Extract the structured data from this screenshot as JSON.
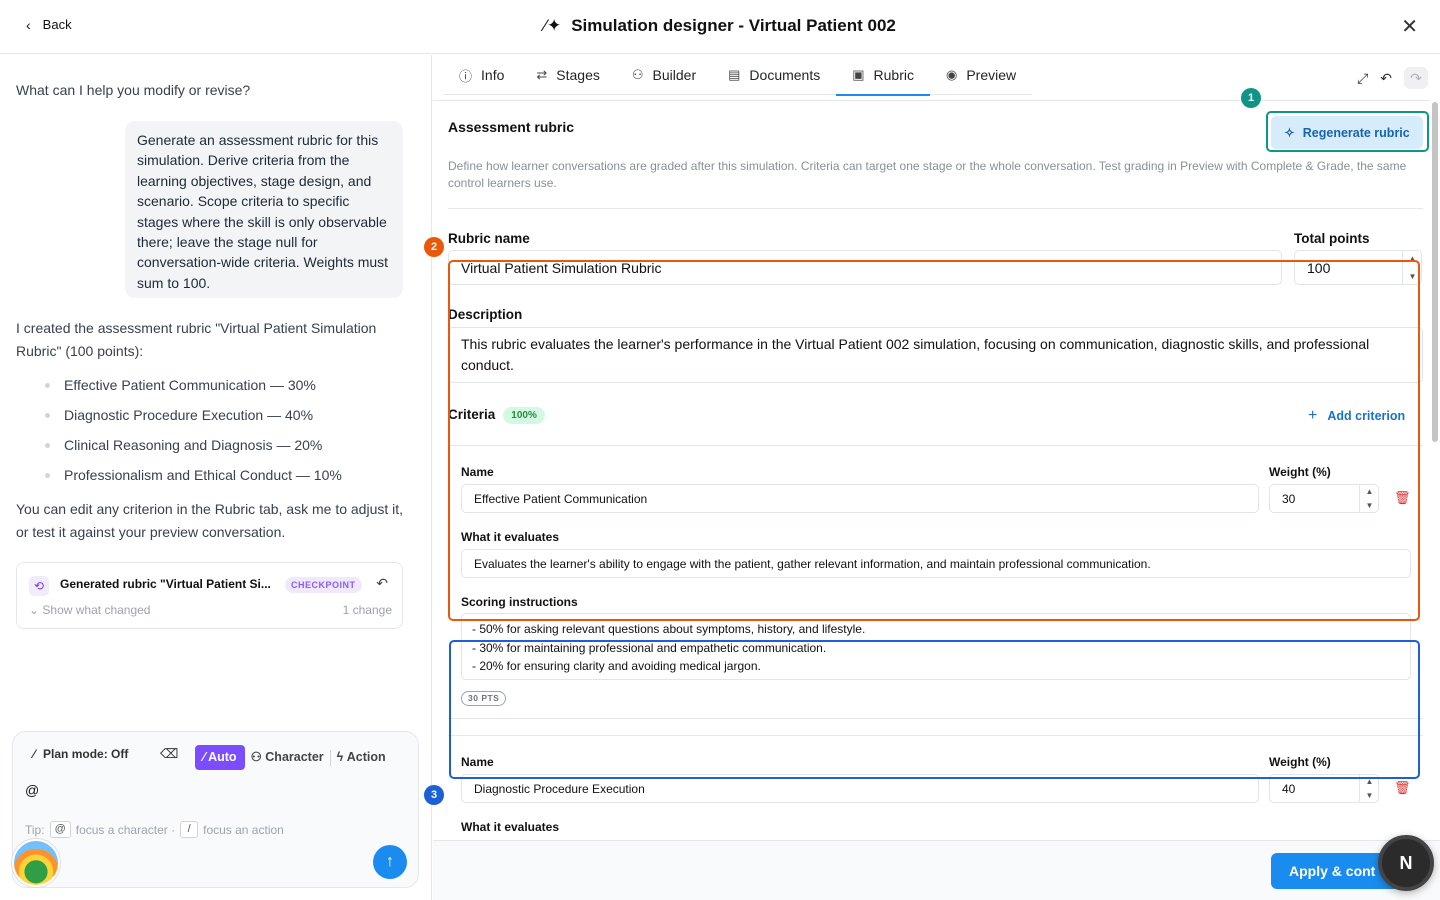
{
  "header": {
    "back_label": "Back",
    "title": "Simulation designer - Virtual Patient 002"
  },
  "chat": {
    "prompt": "What can I help you modify or revise?",
    "user_message": "Generate an assessment rubric for this simulation. Derive criteria from the learning objectives, stage design, and scenario. Scope criteria to specific stages where the skill is only observable there; leave the stage null for conversation-wide criteria. Weights must sum to 100.",
    "assistant_intro": "I created the assessment rubric \"Virtual Patient Simulation Rubric\" (100 points):",
    "bullets": [
      "Effective Patient Communication — 30%",
      "Diagnostic Procedure Execution — 40%",
      "Clinical Reasoning and Diagnosis — 20%",
      "Professionalism and Ethical Conduct — 10%"
    ],
    "assistant_outro": "You can edit any criterion in the Rubric tab, ask me to adjust it, or test it against your preview conversation.",
    "checkpoint": {
      "title": "Generated rubric \"Virtual Patient Si...",
      "badge": "CHECKPOINT",
      "show_changes": "Show what changed",
      "change_count": "1 change"
    }
  },
  "composer": {
    "plan_mode": "Plan mode: Off",
    "modes": {
      "auto": "Auto",
      "character": "Character",
      "action": "Action"
    },
    "input_value": "@",
    "tip_prefix": "Tip:",
    "tip_key1": "@",
    "tip_text1": "focus a character ·",
    "tip_key2": "/",
    "tip_text2": "focus an action"
  },
  "tabs": [
    {
      "label": "Info",
      "icon": "info-icon"
    },
    {
      "label": "Stages",
      "icon": "stages-icon"
    },
    {
      "label": "Builder",
      "icon": "users-icon"
    },
    {
      "label": "Documents",
      "icon": "document-icon"
    },
    {
      "label": "Rubric",
      "icon": "clipboard-icon",
      "active": true
    },
    {
      "label": "Preview",
      "icon": "eye-icon"
    }
  ],
  "rubric": {
    "section_title": "Assessment rubric",
    "regenerate_label": "Regenerate rubric",
    "description_help": "Define how learner conversations are graded after this simulation. Criteria can target one stage or the whole conversation. Test grading in Preview with Complete & Grade, the same control learners use.",
    "name_label": "Rubric name",
    "name_value": "Virtual Patient Simulation Rubric",
    "total_points_label": "Total points",
    "total_points_value": "100",
    "description_label": "Description",
    "description_value": "This rubric evaluates the learner's performance in the Virtual Patient 002 simulation, focusing on communication, diagnostic skills, and professional conduct.",
    "criteria_label": "Criteria",
    "criteria_pct": "100%",
    "add_criterion": "Add criterion",
    "criteria": [
      {
        "name_label": "Name",
        "name": "Effective Patient Communication",
        "weight_label": "Weight (%)",
        "weight": "30",
        "evaluates_label": "What it evaluates",
        "evaluates": "Evaluates the learner's ability to engage with the patient, gather relevant information, and maintain professional communication.",
        "scoring_label": "Scoring instructions",
        "scoring_lines": [
          "- 50% for asking relevant questions about symptoms, history, and lifestyle.",
          "- 30% for maintaining professional and empathetic communication.",
          "- 20% for ensuring clarity and avoiding medical jargon."
        ],
        "points": "30 PTS"
      },
      {
        "name_label": "Name",
        "name": "Diagnostic Procedure Execution",
        "weight_label": "Weight (%)",
        "weight": "40",
        "evaluates_label": "What it evaluates"
      }
    ]
  },
  "annotations": [
    "1",
    "2",
    "3"
  ],
  "footer": {
    "apply_label": "Apply & cont",
    "badge": "N"
  },
  "colors": {
    "accent": "#1a8cf0",
    "annotation_teal": "#0f9488",
    "annotation_orange": "#e8590c",
    "annotation_blue": "#1c5fd6",
    "auto_mode": "#7c4dff"
  }
}
